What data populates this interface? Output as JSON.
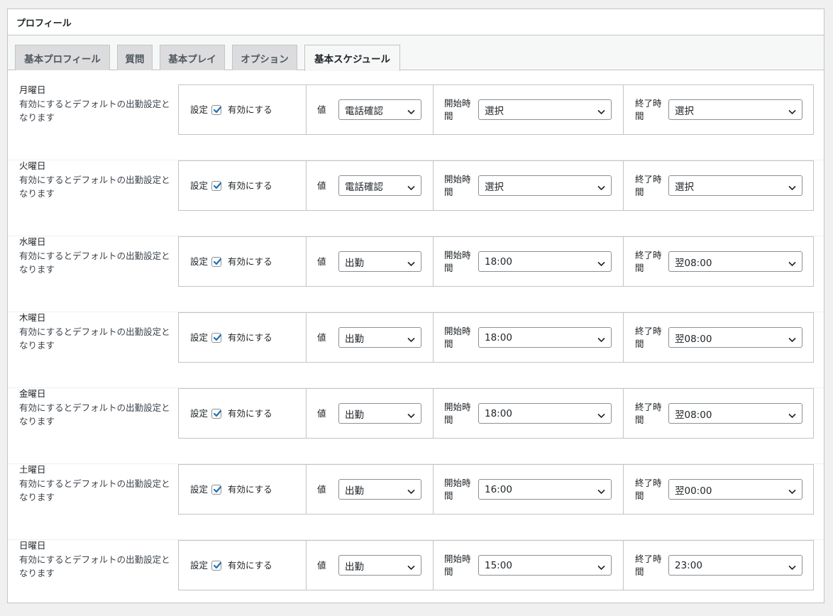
{
  "panel": {
    "title": "プロフィール"
  },
  "tabs": [
    {
      "label": "基本プロフィール",
      "active": false
    },
    {
      "label": "質問",
      "active": false
    },
    {
      "label": "基本プレイ",
      "active": false
    },
    {
      "label": "オプション",
      "active": false
    },
    {
      "label": "基本スケジュール",
      "active": true
    }
  ],
  "schedule": {
    "setting_label": "設定",
    "enable_label": "有効にする",
    "value_label": "値",
    "start_label_line1": "開始時",
    "start_label_line2": "間",
    "end_label_line1": "終了時",
    "end_label_line2": "間",
    "description_line1": "有効にするとデフォルトの出勤設定と",
    "description_line2": "なります",
    "rows": [
      {
        "day": "月曜日",
        "checked": true,
        "value": "電話確認",
        "start": "選択",
        "end": "選択"
      },
      {
        "day": "火曜日",
        "checked": true,
        "value": "電話確認",
        "start": "選択",
        "end": "選択"
      },
      {
        "day": "水曜日",
        "checked": true,
        "value": "出勤",
        "start": "18:00",
        "end": "翌08:00"
      },
      {
        "day": "木曜日",
        "checked": true,
        "value": "出勤",
        "start": "18:00",
        "end": "翌08:00"
      },
      {
        "day": "金曜日",
        "checked": true,
        "value": "出勤",
        "start": "18:00",
        "end": "翌08:00"
      },
      {
        "day": "土曜日",
        "checked": true,
        "value": "出勤",
        "start": "16:00",
        "end": "翌00:00"
      },
      {
        "day": "日曜日",
        "checked": true,
        "value": "出勤",
        "start": "15:00",
        "end": "23:00"
      }
    ]
  },
  "colors": {
    "checkmark": "#2271b1",
    "border": "#c3c4c7"
  }
}
